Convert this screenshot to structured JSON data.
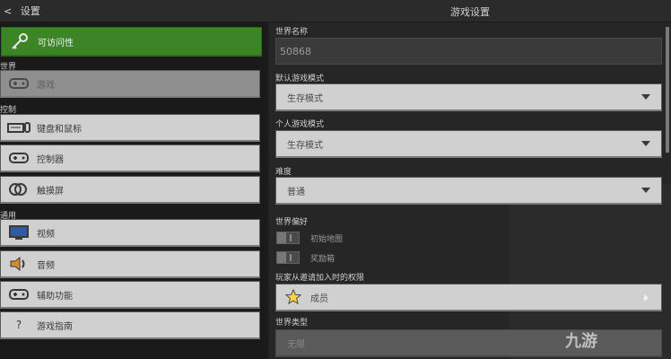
{
  "header": {
    "back_label": "设置",
    "title": "游戏设置"
  },
  "sidebar": {
    "sections": [
      "世界",
      "控制",
      "通用"
    ],
    "items": [
      {
        "label": "可访问性",
        "icon": "key-icon"
      },
      {
        "label": "游戏",
        "icon": "controller-icon"
      },
      {
        "label": "键盘和鼠标",
        "icon": "keyboard-icon"
      },
      {
        "label": "控制器",
        "icon": "controller-icon"
      },
      {
        "label": "触摸屏",
        "icon": "touch-icon"
      },
      {
        "label": "视频",
        "icon": "monitor-icon"
      },
      {
        "label": "音频",
        "icon": "speaker-icon"
      },
      {
        "label": "辅助功能",
        "icon": "controller-icon"
      },
      {
        "label": "游戏指南",
        "icon": "question-icon"
      }
    ]
  },
  "main": {
    "world_name": {
      "label": "世界名称",
      "value": "50868"
    },
    "default_mode": {
      "label": "默认游戏模式",
      "value": "生存模式"
    },
    "personal_mode": {
      "label": "个人游戏模式",
      "value": "生存模式"
    },
    "difficulty": {
      "label": "难度",
      "value": "普通"
    },
    "world_prefs": {
      "label": "世界偏好",
      "toggles": [
        {
          "label": "初始地图"
        },
        {
          "label": "奖励箱"
        }
      ]
    },
    "permission": {
      "label": "玩家从邀请加入时的权限",
      "value": "成员"
    },
    "world_type": {
      "label": "世界类型",
      "value": "无限"
    }
  },
  "watermark": "九游",
  "colors": {
    "accent": "#3c8527",
    "button": "#d0d0d0",
    "panel": "#262626"
  }
}
